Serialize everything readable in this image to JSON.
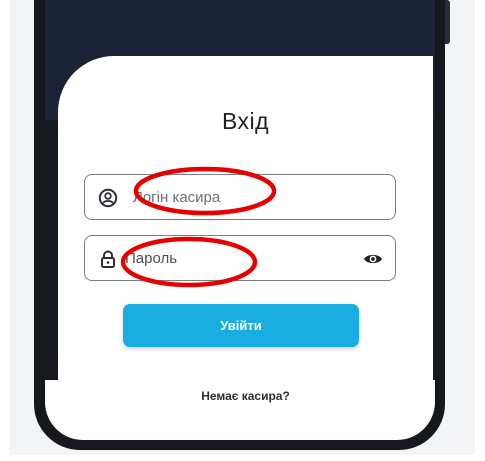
{
  "login_screen": {
    "title": "Вхід",
    "login_field": {
      "placeholder": "Логін касира",
      "icon": "user-circle-icon"
    },
    "password_field": {
      "placeholder": "Пароль",
      "icon": "lock-icon",
      "toggle_icon": "eye-icon"
    },
    "submit_label": "Увійти",
    "no_cashier_link": "Немає касира?"
  },
  "colors": {
    "header_dark": "#1c2237",
    "phone_frame": "#15181d",
    "button": "#1aaee0",
    "annotation": "#e60000"
  }
}
